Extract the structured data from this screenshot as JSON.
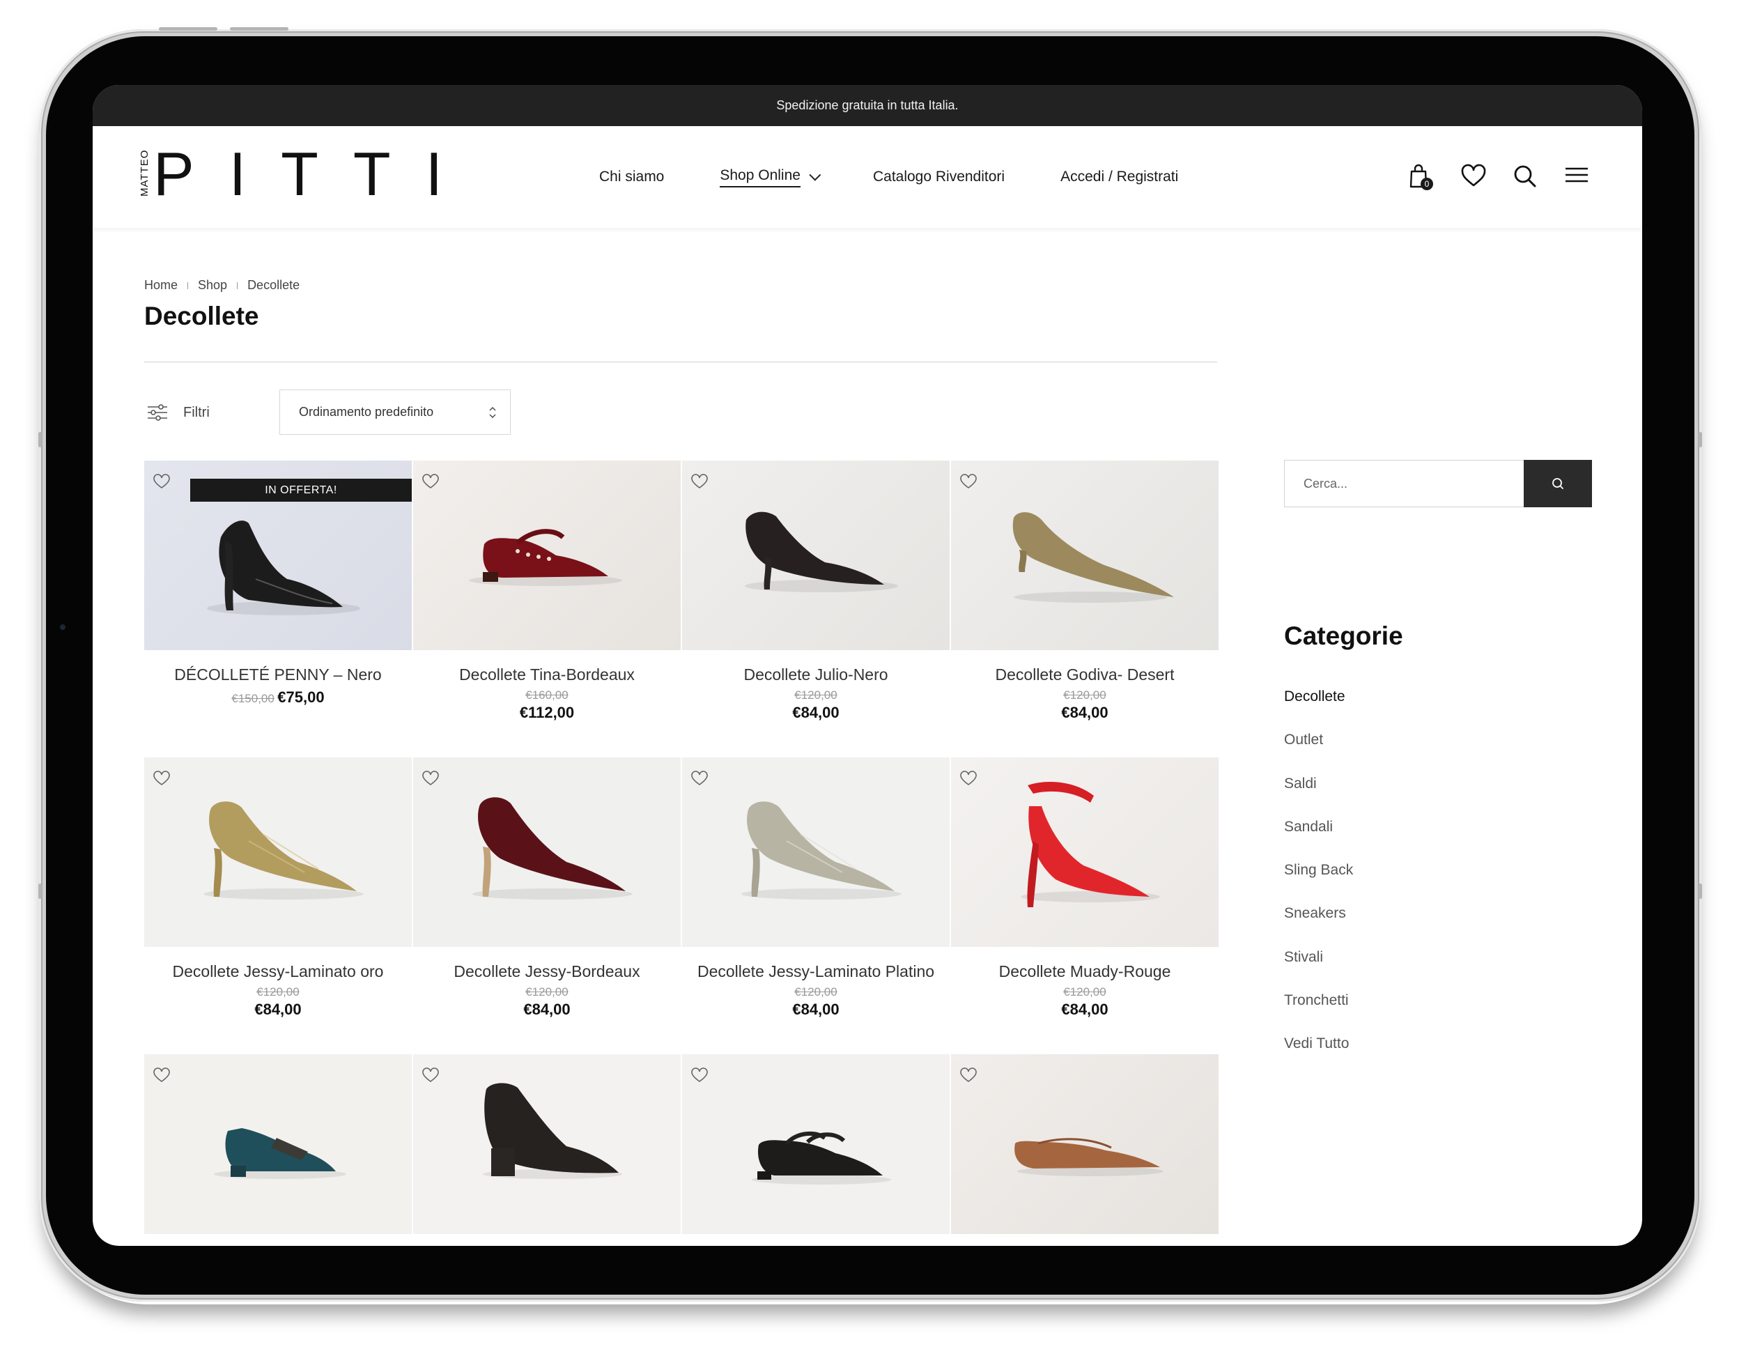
{
  "topbar": {
    "text": "Spedizione gratuita in tutta Italia."
  },
  "logo": {
    "small": "MATTEO",
    "main": "PITTI"
  },
  "nav": [
    {
      "label": "Chi siamo"
    },
    {
      "label": "Shop Online",
      "active": true
    },
    {
      "label": "Catalogo Rivenditori"
    },
    {
      "label": "Accedi / Registrati"
    }
  ],
  "header_icons": {
    "cart": "cart-icon",
    "cart_count": "0",
    "wishlist": "heart-icon",
    "search": "search-icon",
    "menu": "hamburger-menu-icon"
  },
  "breadcrumb": [
    "Home",
    "Shop",
    "Decollete"
  ],
  "page": {
    "title": "Decollete"
  },
  "toolbar": {
    "filters_label": "Filtri",
    "sort_label": "Ordinamento predefinito"
  },
  "products": [
    {
      "name": "DÉCOLLETÉ PENNY – Nero",
      "old_price": "€150,00",
      "price": "€75,00",
      "badge": "IN OFFERTA!"
    },
    {
      "name": "Decollete Tina-Bordeaux",
      "old_price": "€160,00",
      "price": "€112,00"
    },
    {
      "name": "Decollete Julio-Nero",
      "old_price": "€120,00",
      "price": "€84,00"
    },
    {
      "name": "Decollete Godiva- Desert",
      "old_price": "€120,00",
      "price": "€84,00"
    },
    {
      "name": "Decollete Jessy-Laminato oro",
      "old_price": "€120,00",
      "price": "€84,00"
    },
    {
      "name": "Decollete Jessy-Bordeaux",
      "old_price": "€120,00",
      "price": "€84,00"
    },
    {
      "name": "Decollete Jessy-Laminato Platino",
      "old_price": "€120,00",
      "price": "€84,00"
    },
    {
      "name": "Decollete Muady-Rouge",
      "old_price": "€120,00",
      "price": "€84,00"
    },
    {
      "name": "",
      "old_price": "",
      "price": ""
    },
    {
      "name": "",
      "old_price": "",
      "price": ""
    },
    {
      "name": "",
      "old_price": "",
      "price": ""
    },
    {
      "name": "",
      "old_price": "",
      "price": ""
    }
  ],
  "sidebar": {
    "search_placeholder": "Cerca...",
    "categories_title": "Categorie",
    "categories": [
      "Decollete",
      "Outlet",
      "Saldi",
      "Sandali",
      "Sling Back",
      "Sneakers",
      "Stivali",
      "Tronchetti",
      "Vedi Tutto"
    ]
  },
  "colors": {
    "topbar": "#222222",
    "text": "#1c1c1c",
    "badge": "#1a1a1a",
    "search_button": "#2b2b2b"
  }
}
